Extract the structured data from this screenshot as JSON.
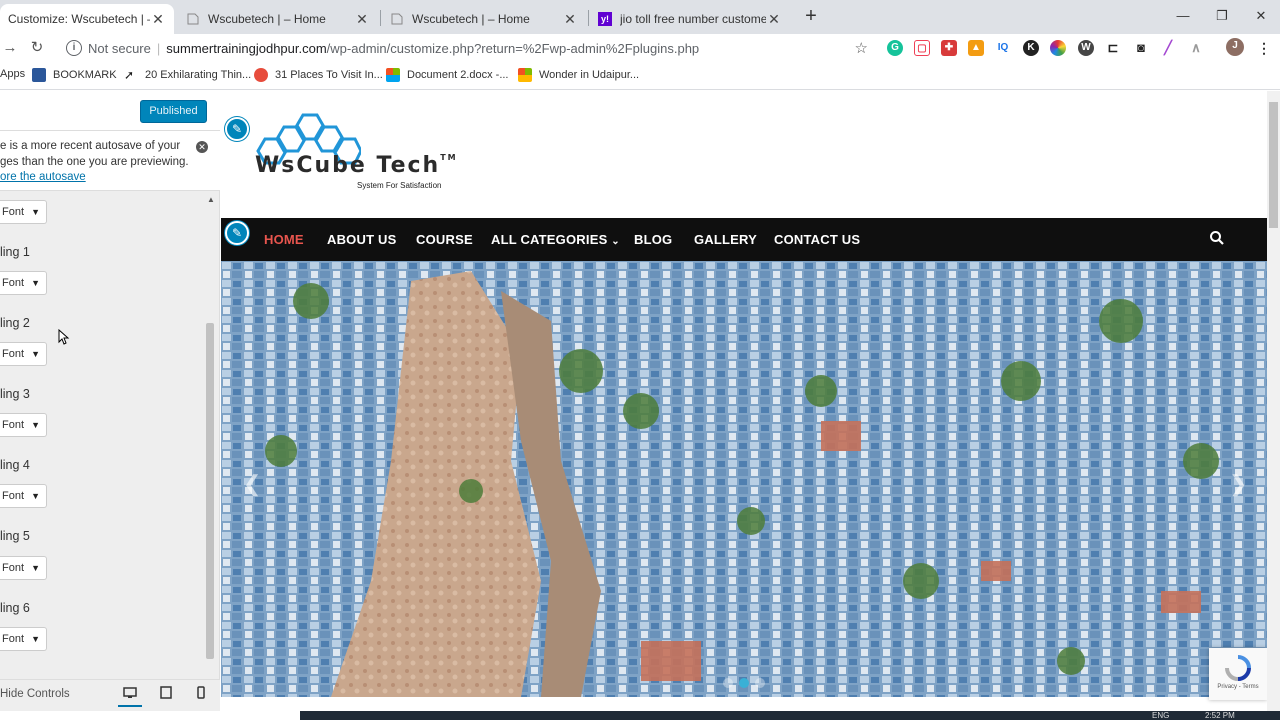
{
  "browser": {
    "tabs": [
      {
        "title": "Customize: Wscubetech | – Home",
        "active": true
      },
      {
        "title": "Wscubetech | – Home",
        "active": false
      },
      {
        "title": "Wscubetech | – Home",
        "active": false
      },
      {
        "title": "jio toll free number customer care",
        "active": false
      }
    ],
    "new_tab": "+",
    "window_controls": {
      "minimize": "—",
      "restore": "❐",
      "close": "✕"
    },
    "nav": {
      "back": "→",
      "reload": "↻"
    },
    "security_label": "Not secure",
    "url_host": "summertrainingjodhpur.com",
    "url_path": "/wp-admin/customize.php?return=%2Fwp-admin%2Fplugins.php",
    "star_icon": "☆",
    "extensions": [
      {
        "name": "grammarly-icon",
        "color": "#15c39a",
        "glyph": "G"
      },
      {
        "name": "pocket-icon",
        "color": "#ef4056",
        "glyph": "▢"
      },
      {
        "name": "puzzle-icon",
        "color": "#d83b3b",
        "glyph": "✚"
      },
      {
        "name": "image-icon",
        "color": "#f39c12",
        "glyph": "▲"
      },
      {
        "name": "iq-icon",
        "color": "#ffffff",
        "glyph": "IQ"
      },
      {
        "name": "k-icon",
        "color": "#222222",
        "glyph": "K"
      },
      {
        "name": "color-wheel-icon",
        "color": "#4caf50",
        "glyph": "●"
      },
      {
        "name": "wordpress-icon",
        "color": "#464646",
        "glyph": "W"
      },
      {
        "name": "cast-icon",
        "color": "#ffffff",
        "glyph": "⊏"
      },
      {
        "name": "camera-icon",
        "color": "#ffffff",
        "glyph": "◙"
      },
      {
        "name": "pen-icon",
        "color": "#ffffff",
        "glyph": "╱"
      },
      {
        "name": "signal-icon",
        "color": "#ffffff",
        "glyph": "∧"
      }
    ],
    "profile_initial": "J",
    "menu_icon": "⋮",
    "bookmarks": [
      {
        "label": "Apps",
        "icon_color": "#4285f4"
      },
      {
        "label": "BOOKMARK",
        "icon_color": "#2b579a"
      },
      {
        "label": "20 Exhilarating Thin...",
        "icon_color": "#1a1a1a"
      },
      {
        "label": "31 Places To Visit In...",
        "icon_color": "#e74c3c"
      },
      {
        "label": "Document 2.docx -...",
        "icon_color": "#f25022"
      },
      {
        "label": "Wonder in Udaipur...",
        "icon_color": "#f25022"
      }
    ]
  },
  "customizer": {
    "publish_label": "Published",
    "notice": {
      "line1": "e is a more recent autosave of your",
      "line2": "ges than the one you are previewing.",
      "link": "ore the autosave"
    },
    "top_select": "Font",
    "headings": [
      {
        "label": "ling 1",
        "select": "Font"
      },
      {
        "label": "ling 2",
        "select": "Font"
      },
      {
        "label": "ling 3",
        "select": "Font"
      },
      {
        "label": "ling 4",
        "select": "Font"
      },
      {
        "label": "ling 5",
        "select": "Font"
      },
      {
        "label": "ling 6",
        "select": "Font"
      }
    ],
    "hide_controls": "Hide Controls"
  },
  "site": {
    "logo_text": "WsCube Tech",
    "logo_tm": "TM",
    "tagline": "System For Satisfaction",
    "menu": [
      {
        "label": "HOME",
        "active": true
      },
      {
        "label": "ABOUT US",
        "active": false
      },
      {
        "label": "COURSE",
        "active": false
      },
      {
        "label": "ALL CATEGORIES",
        "active": false,
        "has_dropdown": true
      },
      {
        "label": "BLOG",
        "active": false
      },
      {
        "label": "GALLERY",
        "active": false
      },
      {
        "label": "CONTACT US",
        "active": false
      }
    ],
    "slider_dots": 3,
    "slider_active_dot": 1,
    "recaptcha_text": "Privacy - Terms",
    "accent_color": "#e8554e",
    "brand_blue": "#0085ba"
  },
  "taskbar": {
    "lang": "ENG",
    "time": "2:52 PM"
  }
}
